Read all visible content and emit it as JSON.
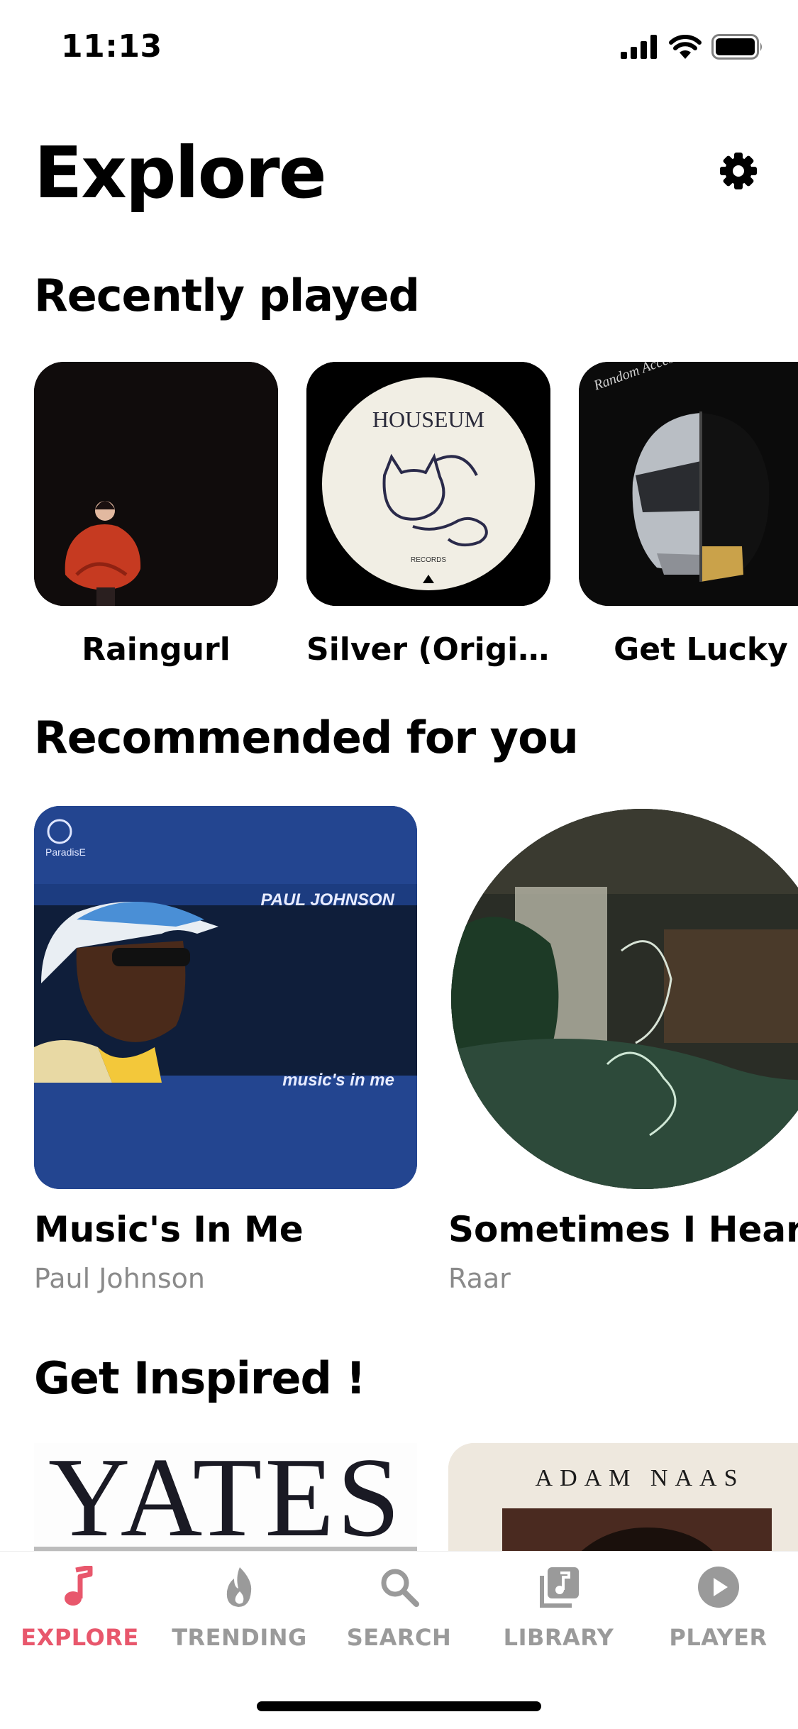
{
  "status_bar": {
    "time": "11:13"
  },
  "page": {
    "title": "Explore"
  },
  "sections": {
    "recently_played": {
      "title": "Recently played",
      "items": [
        {
          "label": "Raingurl"
        },
        {
          "label": "Silver (Origin…"
        },
        {
          "label": "Get Lucky"
        }
      ]
    },
    "recommended": {
      "title": "Recommended for you",
      "items": [
        {
          "title": "Music's In Me",
          "artist": "Paul Johnson",
          "art_text_top": "PAUL JOHNSON",
          "art_text_bottom": "music's in me",
          "art_logo": "ParadisE"
        },
        {
          "title": "Sometimes I Hear S",
          "artist": "Raar"
        }
      ]
    },
    "inspired": {
      "title": "Get Inspired !",
      "items": [
        {
          "art_text": "YATES"
        },
        {
          "art_text": "ADAM NAAS"
        }
      ]
    }
  },
  "album_art": {
    "houseum_text": "HOUSEUM",
    "houseum_sub": "RECORDS",
    "ram_text": "Random Access Memories"
  },
  "tabs": [
    {
      "label": "EXPLORE",
      "icon": "music-note-icon",
      "active": true
    },
    {
      "label": "TRENDING",
      "icon": "flame-icon",
      "active": false
    },
    {
      "label": "SEARCH",
      "icon": "search-icon",
      "active": false
    },
    {
      "label": "LIBRARY",
      "icon": "library-icon",
      "active": false
    },
    {
      "label": "PLAYER",
      "icon": "play-circle-icon",
      "active": false
    }
  ],
  "colors": {
    "accent": "#e8576c",
    "inactive": "#9a9a9a",
    "artist_grey": "#8a8a8a"
  }
}
